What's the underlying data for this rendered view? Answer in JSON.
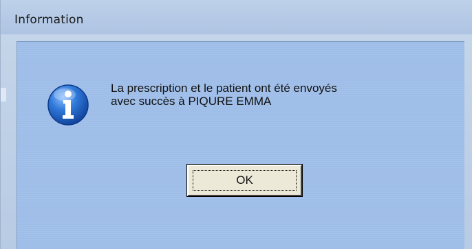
{
  "window": {
    "title": "Information"
  },
  "dialog": {
    "icon": "info-icon",
    "message_line1": "La prescription et le patient ont été envoyés",
    "message_line2": "avec succès à PIQURE EMMA",
    "ok_label": "OK"
  },
  "colors": {
    "titlebar": "#b4c9e6",
    "client_bg": "#9ebde8",
    "icon_blue": "#1f5fbf",
    "button_face": "#ece9d8"
  }
}
